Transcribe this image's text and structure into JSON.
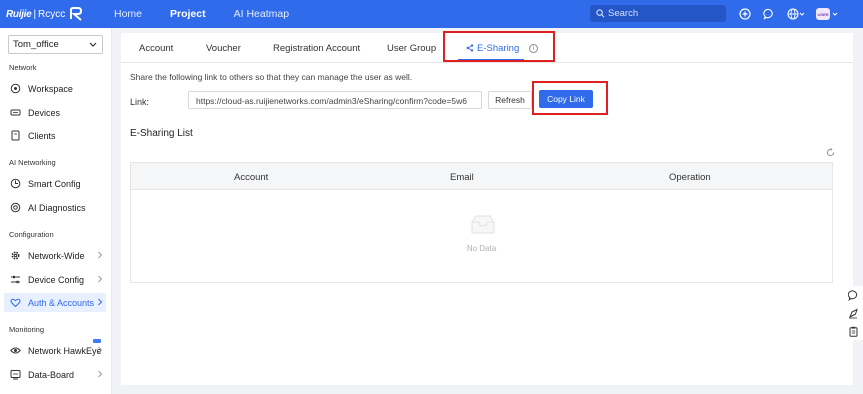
{
  "app": {
    "logo_brand": "Ruijie",
    "logo_sep": "|",
    "logo_product": "Rcycc"
  },
  "topnav": {
    "items": [
      "Home",
      "Project",
      "AI Heatmap"
    ],
    "active": "Project",
    "search_placeholder": "Search",
    "avatar_text": "USER"
  },
  "sidebar": {
    "project": "Tom_office",
    "groups": {
      "network": "Network",
      "ai_networking": "AI Networking",
      "configuration": "Configuration",
      "monitoring": "Monitoring"
    },
    "items": {
      "workspace": "Workspace",
      "devices": "Devices",
      "clients": "Clients",
      "smart_config": "Smart Config",
      "ai_diagnostics": "AI Diagnostics",
      "network_wide": "Network-Wide",
      "device_config": "Device Config",
      "auth_accounts": "Auth & Accounts",
      "network_hawkeye": "Network HawkEye",
      "data_board": "Data-Board"
    },
    "active": "auth_accounts"
  },
  "tabs": {
    "account": "Account",
    "voucher": "Voucher",
    "registration": "Registration Account",
    "user_group": "User Group",
    "esharing": "E-Sharing",
    "active": "esharing"
  },
  "esharing": {
    "description": "Share the following link to others so that they can manage the user as well.",
    "link_label": "Link:",
    "link_value": "https://cloud-as.ruijienetworks.com/admin3/eSharing/confirm?code=5w6",
    "refresh_label": "Refresh",
    "copy_label": "Copy Link",
    "list_title": "E-Sharing List",
    "columns": [
      "Account",
      "Email",
      "Operation"
    ],
    "rows": [],
    "empty_text": "No Data"
  },
  "colors": {
    "primary": "#2f6bea",
    "highlight": "#e02020",
    "active_bg": "#e8efff"
  }
}
